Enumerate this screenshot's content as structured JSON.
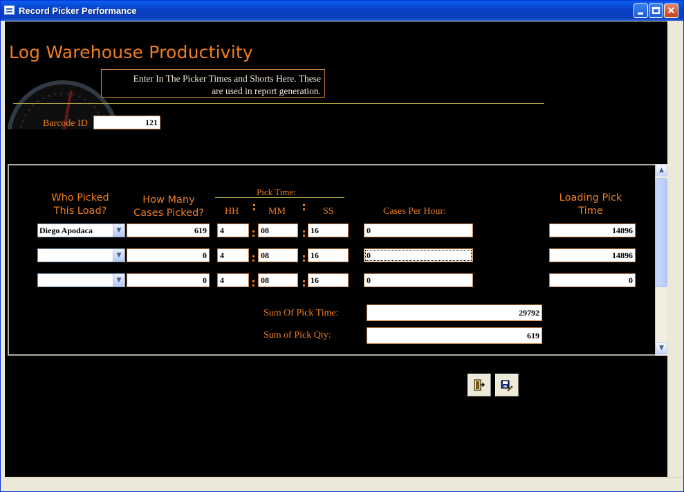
{
  "window": {
    "title": "Record Picker Performance"
  },
  "header": {
    "title": "Log Warehouse Productivity",
    "info_line1": "Enter In The Picker Times and Shorts Here. These",
    "info_line2": "are used in report generation."
  },
  "barcode": {
    "label": "Barcode ID",
    "value": "121"
  },
  "columns": {
    "who_picked_line1": "Who Picked",
    "who_picked_line2": "This Load?",
    "cases_line1": "How Many",
    "cases_line2": "Cases Picked?",
    "pick_time": "Pick Time:",
    "hh": "HH",
    "mm": "MM",
    "ss": "SS",
    "cases_per_hour": "Cases Per Hour:",
    "loading_line1": "Loading Pick",
    "loading_line2": "Time"
  },
  "rows": [
    {
      "picker": "Diego Apodaca",
      "cases": "619",
      "hh": "4",
      "mm": "08",
      "ss": "16",
      "cph": "0",
      "loading": "14896"
    },
    {
      "picker": "",
      "cases": "0",
      "hh": "4",
      "mm": "08",
      "ss": "16",
      "cph": "0",
      "loading": "14896"
    },
    {
      "picker": "",
      "cases": "0",
      "hh": "4",
      "mm": "08",
      "ss": "16",
      "cph": "0",
      "loading": "0"
    }
  ],
  "totals": {
    "sum_pick_time_label": "Sum Of Pick Time:",
    "sum_pick_time": "29792",
    "sum_pick_qty_label": "Sum of Pick Qty:",
    "sum_pick_qty": "619"
  },
  "colors": {
    "accent": "#f07e1e",
    "background": "#000000",
    "titlebar": "#0842c8"
  },
  "icons": {
    "exit": "exit-door-icon",
    "save": "save-record-icon"
  }
}
